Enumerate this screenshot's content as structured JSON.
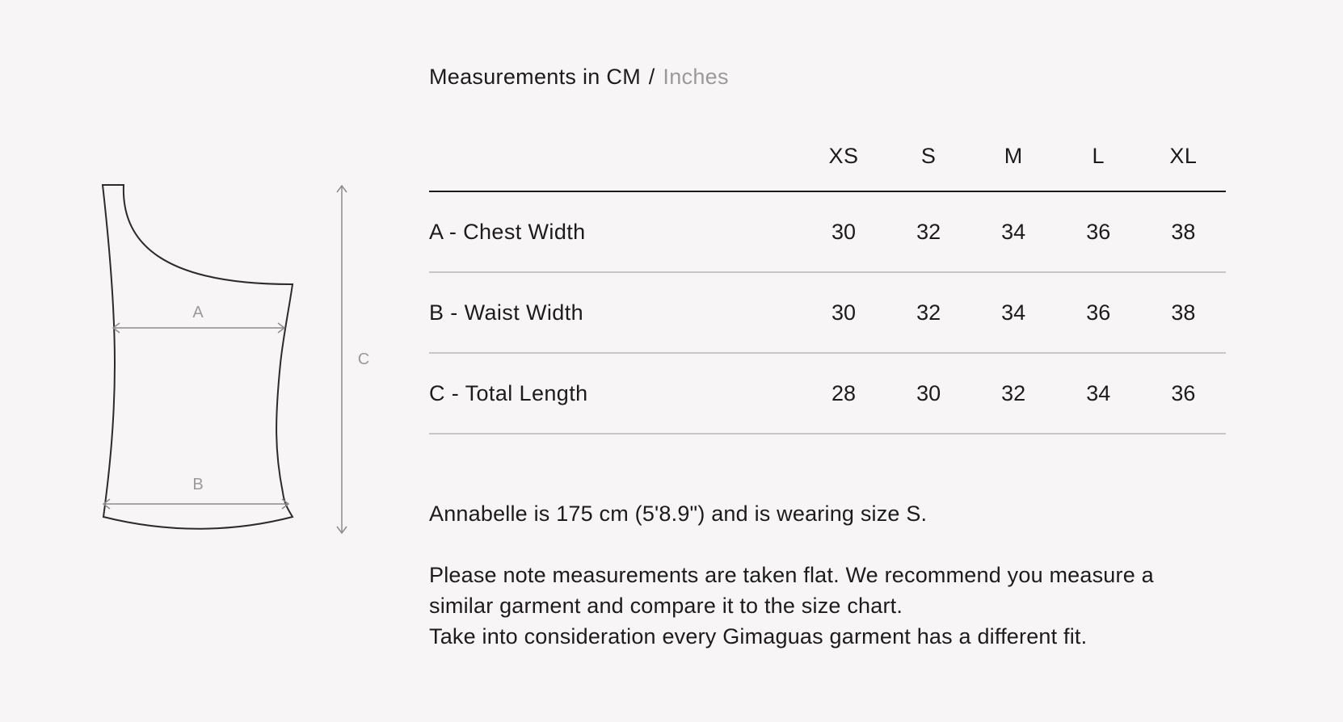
{
  "header": {
    "units_active": "Measurements in CM",
    "separator": "/",
    "units_alt": "Inches"
  },
  "diagram": {
    "label_a": "A",
    "label_b": "B",
    "label_c": "C",
    "line_color": "#2b2b2b",
    "guide_color": "#8c8c8c"
  },
  "table": {
    "sizes": [
      "XS",
      "S",
      "M",
      "L",
      "XL"
    ],
    "rows": [
      {
        "label": "A - Chest Width",
        "values": [
          "30",
          "32",
          "34",
          "36",
          "38"
        ]
      },
      {
        "label": "B - Waist Width",
        "values": [
          "30",
          "32",
          "34",
          "36",
          "38"
        ]
      },
      {
        "label": "C - Total Length",
        "values": [
          "28",
          "30",
          "32",
          "34",
          "36"
        ]
      }
    ]
  },
  "notes": {
    "model": "Annabelle is 175 cm (5'8.9\") and is wearing size S.",
    "line1": "Please note measurements are taken flat. We recommend you measure a",
    "line2": "similar garment and compare it to the size chart.",
    "line3": "Take into consideration every Gimaguas garment has a different fit."
  }
}
